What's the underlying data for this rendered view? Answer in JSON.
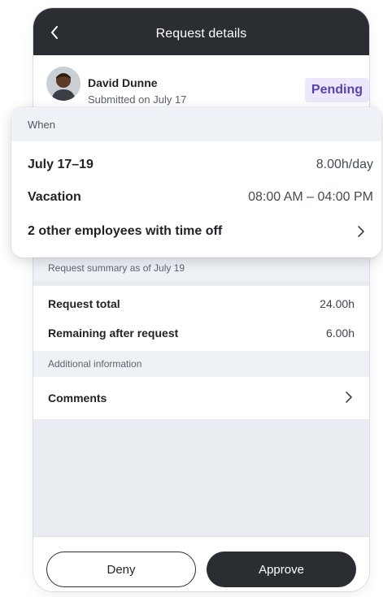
{
  "header": {
    "title": "Request details",
    "back_icon": "chevron-left-icon"
  },
  "requester": {
    "name": "David Dunne",
    "submitted": "Submitted on July 17",
    "status": "Pending"
  },
  "when": {
    "heading": "When",
    "dates": "July 17–19",
    "hours_per_day": "8.00h/day",
    "type": "Vacation",
    "time_range": "08:00 AM – 04:00 PM",
    "others_label": "2 other employees with time off"
  },
  "summary": {
    "heading": "Request summary as of July 19",
    "rows": [
      {
        "label": "Request total",
        "value": "24.00h"
      },
      {
        "label": "Remaining after request",
        "value": "6.00h"
      }
    ]
  },
  "additional": {
    "heading": "Additional information",
    "comments_label": "Comments"
  },
  "actions": {
    "deny_label": "Deny",
    "approve_label": "Approve"
  },
  "colors": {
    "topbar": "#2a2e33",
    "pending_bg": "#ece7fb",
    "pending_text": "#5a3fb1",
    "section_bg": "#eef2f7"
  }
}
